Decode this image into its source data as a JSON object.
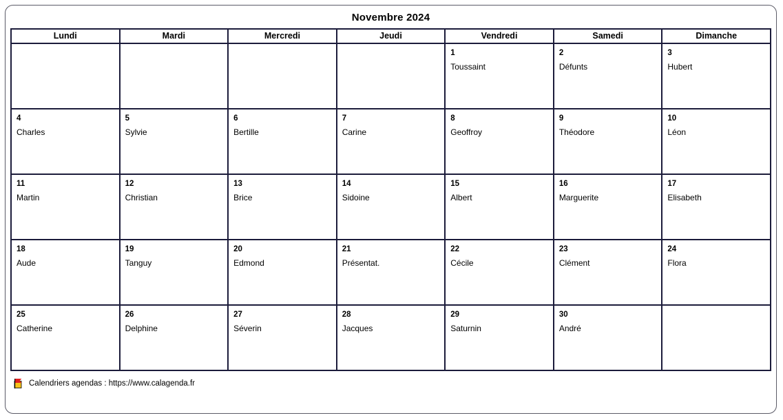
{
  "document": {
    "title": "Novembre 2024"
  },
  "weekday_headers": [
    "Lundi",
    "Mardi",
    "Mercredi",
    "Jeudi",
    "Vendredi",
    "Samedi",
    "Dimanche"
  ],
  "weeks": [
    [
      {
        "number": "",
        "saint": ""
      },
      {
        "number": "",
        "saint": ""
      },
      {
        "number": "",
        "saint": ""
      },
      {
        "number": "",
        "saint": ""
      },
      {
        "number": "1",
        "saint": "Toussaint"
      },
      {
        "number": "2",
        "saint": "Défunts"
      },
      {
        "number": "3",
        "saint": "Hubert"
      }
    ],
    [
      {
        "number": "4",
        "saint": "Charles"
      },
      {
        "number": "5",
        "saint": "Sylvie"
      },
      {
        "number": "6",
        "saint": "Bertille"
      },
      {
        "number": "7",
        "saint": "Carine"
      },
      {
        "number": "8",
        "saint": "Geoffroy"
      },
      {
        "number": "9",
        "saint": "Théodore"
      },
      {
        "number": "10",
        "saint": "Léon"
      }
    ],
    [
      {
        "number": "11",
        "saint": "Martin"
      },
      {
        "number": "12",
        "saint": "Christian"
      },
      {
        "number": "13",
        "saint": "Brice"
      },
      {
        "number": "14",
        "saint": "Sidoine"
      },
      {
        "number": "15",
        "saint": "Albert"
      },
      {
        "number": "16",
        "saint": "Marguerite"
      },
      {
        "number": "17",
        "saint": "Elisabeth"
      }
    ],
    [
      {
        "number": "18",
        "saint": "Aude"
      },
      {
        "number": "19",
        "saint": "Tanguy"
      },
      {
        "number": "20",
        "saint": "Edmond"
      },
      {
        "number": "21",
        "saint": "Présentat."
      },
      {
        "number": "22",
        "saint": "Cécile"
      },
      {
        "number": "23",
        "saint": "Clément"
      },
      {
        "number": "24",
        "saint": "Flora"
      }
    ],
    [
      {
        "number": "25",
        "saint": "Catherine"
      },
      {
        "number": "26",
        "saint": "Delphine"
      },
      {
        "number": "27",
        "saint": "Séverin"
      },
      {
        "number": "28",
        "saint": "Jacques"
      },
      {
        "number": "29",
        "saint": "Saturnin"
      },
      {
        "number": "30",
        "saint": "André"
      },
      {
        "number": "",
        "saint": ""
      }
    ]
  ],
  "footer": {
    "icon": "calagenda-flag-logo-icon",
    "text": "Calendriers agendas : https://www.calagenda.fr"
  },
  "colors": {
    "grid_border": "#1b1b3a",
    "frame_border": "#5a5a66",
    "text": "#000000",
    "page_background": "#ffffff",
    "logo_red": "#e02020",
    "logo_yellow": "#f5c21b"
  }
}
